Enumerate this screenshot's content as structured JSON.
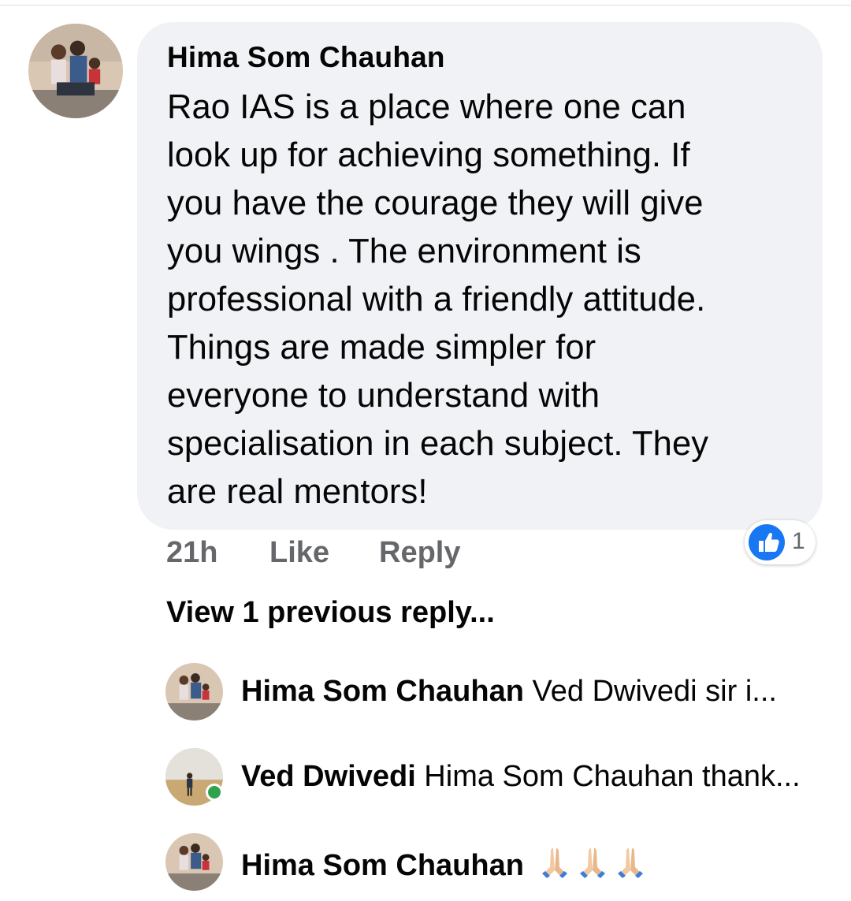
{
  "comment": {
    "author": "Hima Som Chauhan",
    "text": "Rao IAS  is a place where one can\nlook up for achieving something. If\nyou have the courage they will give\nyou wings . The environment is\nprofessional with a friendly attitude.\nThings are made simpler for\neveryone to understand with\nspecialisation in each subject. They\nare real mentors!",
    "time": "21h",
    "like_label": "Like",
    "reply_label": "Reply",
    "reaction_count": "1",
    "reaction_icon": "like-icon"
  },
  "view_previous_label": "View 1 previous reply...",
  "replies": [
    {
      "author": "Hima Som Chauhan",
      "snippet": " Ved Dwivedi  sir i..."
    },
    {
      "author": "Ved Dwivedi",
      "snippet": " Hima Som Chauhan thank...",
      "online": true
    },
    {
      "author": "Hima Som Chauhan",
      "snippet": "",
      "emoji": "folded-hands-icon",
      "emoji_count": 3
    }
  ],
  "colors": {
    "bubble": "#f0f2f5",
    "meta_text": "#65676b",
    "like_blue": "#1877f2",
    "online_green": "#31a24c"
  }
}
